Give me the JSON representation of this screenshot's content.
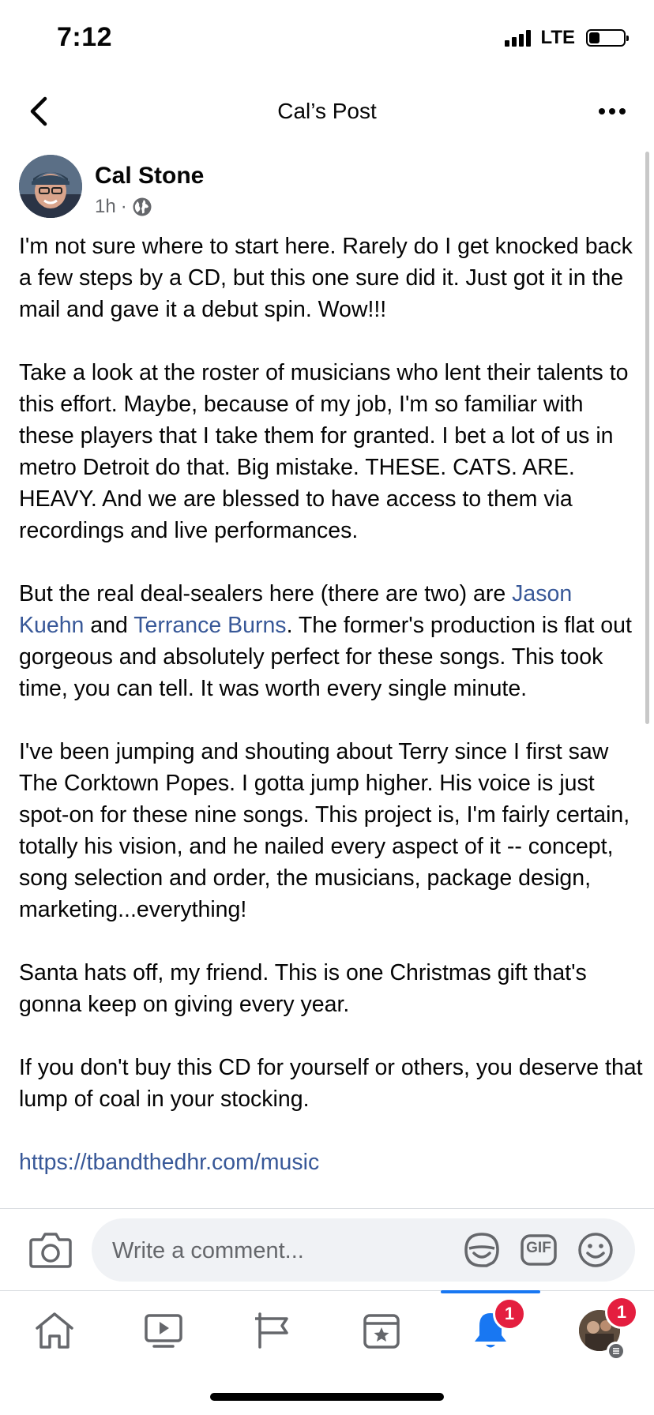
{
  "status_bar": {
    "time": "7:12",
    "network": "LTE",
    "battery_level": 0.3
  },
  "header": {
    "title": "Cal’s Post"
  },
  "post": {
    "author": "Cal Stone",
    "time": "1h",
    "meta_separator": "·",
    "paragraphs": {
      "p1": "I'm not sure where to start here. Rarely do I get knocked back a few steps by a CD, but this one sure did it. Just got it in the mail and gave it a debut spin. Wow!!!",
      "p2": "Take a look at the roster of musicians who lent their talents to this effort. Maybe, because of my job, I'm so familiar with these players that I take them for granted. I bet a lot of us in metro Detroit do that. Big mistake. THESE. CATS. ARE. HEAVY. And we are blessed to have access to them via recordings and live performances.",
      "p3_start": "But the real deal-sealers here (there are two) are ",
      "p3_link1": "Jason Kuehn",
      "p3_and": " and ",
      "p3_link2": "Terrance Burns",
      "p3_end": ". The former's production is flat out gorgeous and absolutely perfect for these songs. This took time, you can tell. It was worth every single minute.",
      "p4": "I've been jumping and shouting about Terry since I first saw The Corktown Popes. I gotta jump higher. His voice is just spot-on for these nine songs. This project is, I'm fairly certain, totally his vision, and he nailed every aspect of it -- concept, song selection and order, the musicians, package design, marketing...everything!",
      "p5": "Santa hats off, my friend. This is one Christmas gift that's gonna keep on giving every year.",
      "p6": "If you don't buy this CD for yourself or others, you deserve that lump of coal in your stocking.",
      "url": "https://tbandthedhr.com/music"
    }
  },
  "comment_bar": {
    "placeholder": "Write a comment...",
    "gif_label": "GIF"
  },
  "nav": {
    "active": "notifications",
    "notifications_badge": "1",
    "menu_badge": "1"
  },
  "colors": {
    "link": "#385898",
    "accent": "#1877f2",
    "badge": "#e41e3f"
  }
}
